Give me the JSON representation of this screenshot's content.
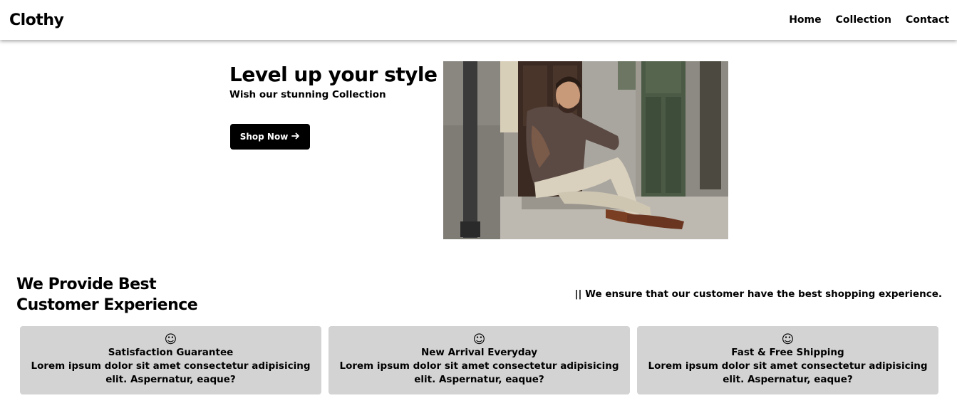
{
  "navbar": {
    "brand": "Clothy",
    "links": [
      "Home",
      "Collection",
      "Contact"
    ]
  },
  "hero": {
    "title": "Level up your style",
    "subtitle": "Wish our stunning Collection",
    "button_label": "Shop Now",
    "button_icon": "arrow-right-icon",
    "image_description": "man-sitting-on-doorstep-photo"
  },
  "features": {
    "title_line1": "We Provide Best",
    "title_line2": "Customer Experience",
    "note": "|| We ensure that our customer have the best shopping experience.",
    "cards": [
      {
        "icon": "smiley-icon",
        "title": "Satisfaction Guarantee",
        "text": "Lorem ipsum dolor sit amet consectetur adipisicing elit. Aspernatur, eaque?"
      },
      {
        "icon": "smiley-icon",
        "title": "New Arrival Everyday",
        "text": "Lorem ipsum dolor sit amet consectetur adipisicing elit. Aspernatur, eaque?"
      },
      {
        "icon": "smiley-icon",
        "title": "Fast & Free Shipping",
        "text": "Lorem ipsum dolor sit amet consectetur adipisicing elit. Aspernatur, eaque?"
      }
    ]
  },
  "colors": {
    "background": "#ffffff",
    "card_bg": "#d3d3d3",
    "button_bg": "#000000",
    "button_text": "#ffffff"
  }
}
